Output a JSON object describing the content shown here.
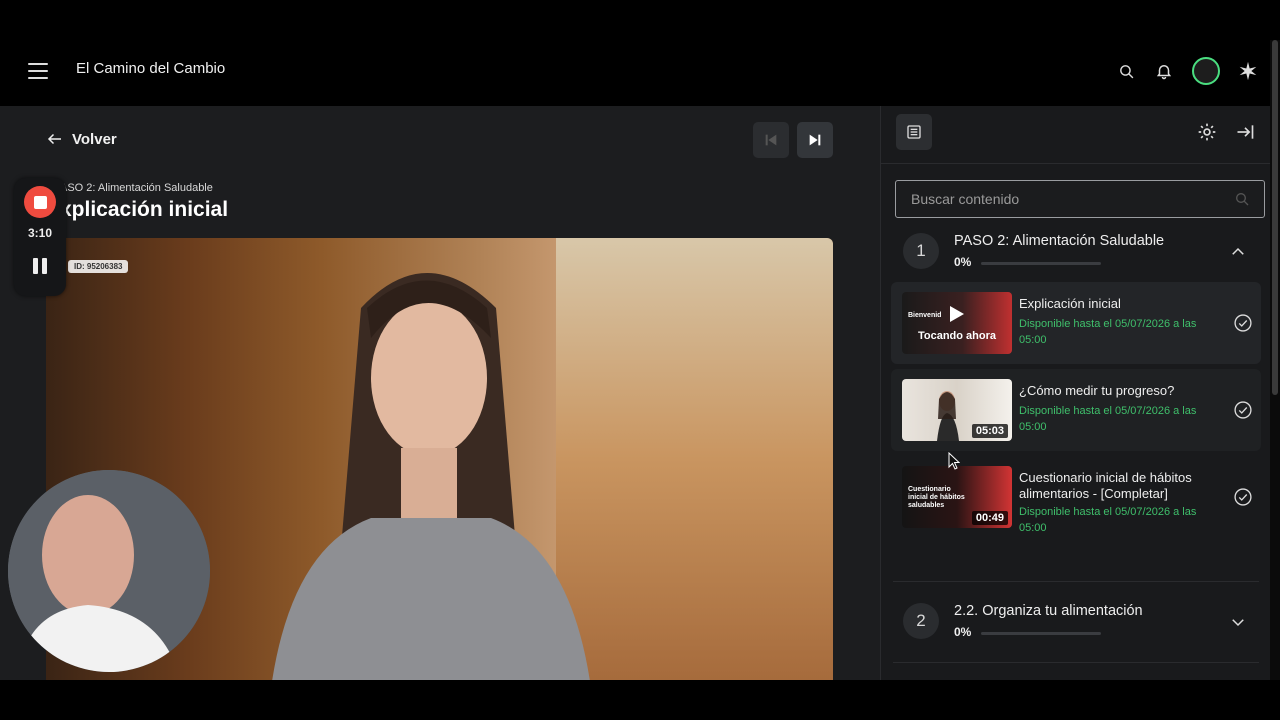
{
  "app": {
    "title": "El Camino del Cambio"
  },
  "player": {
    "back_label": "Volver",
    "breadcrumb": "ASO 2: Alimentación Saludable",
    "lesson_title": "xplicación inicial",
    "video_id": "ID: 95206383"
  },
  "recorder": {
    "time": "3:10"
  },
  "sidebar": {
    "search_placeholder": "Buscar contenido",
    "sections": [
      {
        "number": "1",
        "title": "PASO 2: Alimentación Saludable",
        "progress_label": "0%",
        "progress": 0,
        "expanded": true
      },
      {
        "number": "2",
        "title": "2.2. Organiza tu alimentación",
        "progress_label": "0%",
        "progress": 0,
        "expanded": false
      }
    ],
    "items": [
      {
        "title": "Explicación inicial",
        "availability": "Disponible hasta el 05/07/2026 a las 05:00",
        "thumb_badge": "Tocando ahora",
        "thumb_caption": "Bienvenid",
        "state": "playing"
      },
      {
        "title": "¿Cómo medir tu progreso?",
        "availability": "Disponible hasta el 05/07/2026 a las 05:00",
        "duration": "05:03",
        "state": "default"
      },
      {
        "title": "Cuestionario inicial de hábitos alimentarios - [Completar]",
        "availability": "Disponible hasta el 05/07/2026 a las 05:00",
        "duration": "00:49",
        "thumb_caption": "Cuestionario inicial de hábitos saludables",
        "state": "default"
      }
    ]
  },
  "colors": {
    "accent_green": "#4ade80",
    "record_red": "#ef4b3f",
    "availability_green": "#3fbf6b"
  },
  "icons": [
    "menu-icon",
    "search-icon",
    "bell-icon",
    "avatar-icon",
    "sparkle-icon",
    "arrow-left-icon",
    "skip-previous-icon",
    "skip-next-icon",
    "list-icon",
    "gear-icon",
    "collapse-panel-icon",
    "chevron-up-icon",
    "chevron-down-icon",
    "check-circle-icon",
    "play-icon",
    "stop-icon",
    "pause-icon"
  ]
}
